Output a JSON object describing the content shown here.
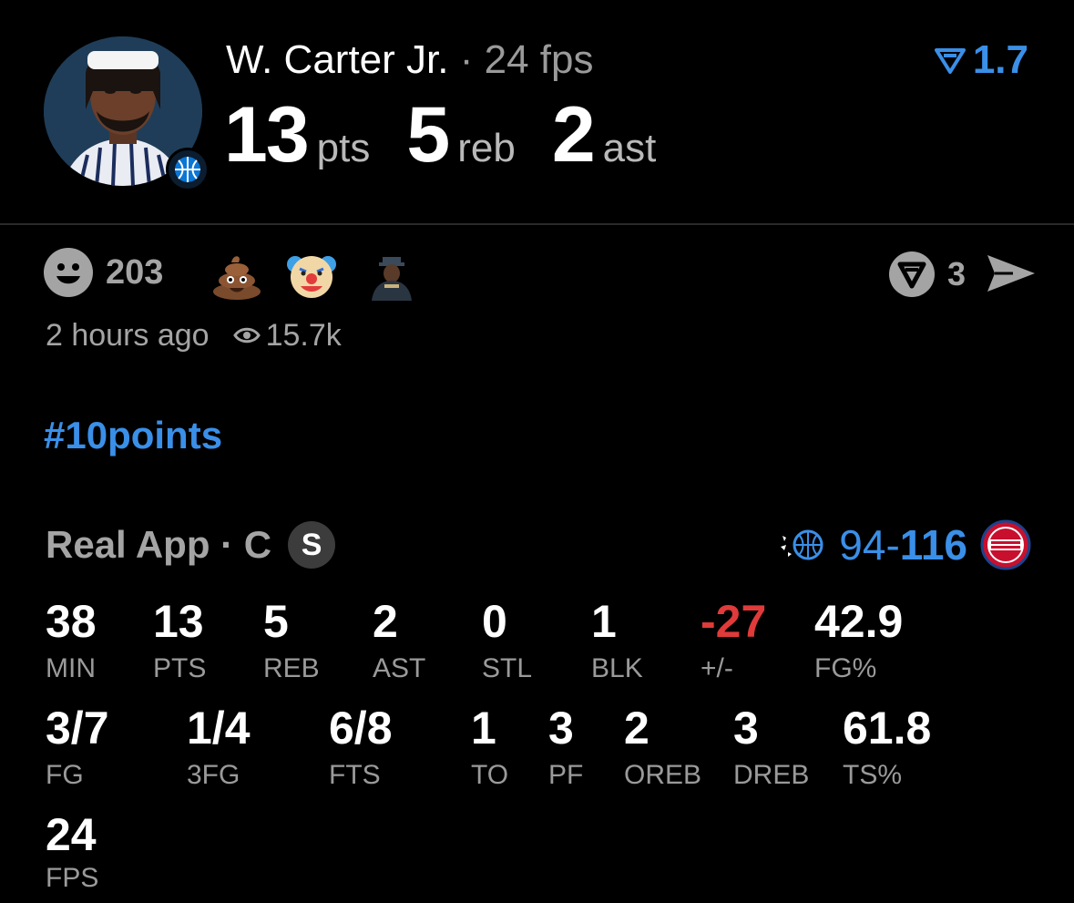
{
  "header": {
    "player_name": "W. Carter Jr.",
    "separator": "·",
    "player_fps": "24 fps",
    "rating": "1.7",
    "headline": [
      {
        "value": "13",
        "label": "pts"
      },
      {
        "value": "5",
        "label": "reb"
      },
      {
        "value": "2",
        "label": "ast"
      }
    ]
  },
  "reactions": {
    "count": "203",
    "emojis": [
      "💩",
      "🤡"
    ],
    "comments": "3"
  },
  "meta": {
    "time": "2 hours ago",
    "views": "15.7k"
  },
  "hashtag": "#10points",
  "game": {
    "source": "Real App · C",
    "position_badge": "S",
    "score_away": "94-",
    "score_home": "116"
  },
  "stats_row1": [
    {
      "value": "38",
      "label": "MIN"
    },
    {
      "value": "13",
      "label": "PTS"
    },
    {
      "value": "5",
      "label": "REB"
    },
    {
      "value": "2",
      "label": "AST"
    },
    {
      "value": "0",
      "label": "STL"
    },
    {
      "value": "1",
      "label": "BLK"
    },
    {
      "value": "-27",
      "label": "+/-"
    },
    {
      "value": "42.9",
      "label": "FG%"
    }
  ],
  "stats_row2": [
    {
      "value": "3/7",
      "label": "FG"
    },
    {
      "value": "1/4",
      "label": "3FG"
    },
    {
      "value": "6/8",
      "label": "FTS"
    },
    {
      "value": "1",
      "label": "TO"
    },
    {
      "value": "3",
      "label": "PF"
    },
    {
      "value": "2",
      "label": "OREB"
    },
    {
      "value": "3",
      "label": "DREB"
    },
    {
      "value": "61.8",
      "label": "TS%"
    }
  ],
  "stats_row3": [
    {
      "value": "24",
      "label": "FPS"
    }
  ],
  "colors": {
    "accent": "#3a8fe8",
    "negative": "#e03a3a",
    "muted": "#9a9a9a"
  }
}
